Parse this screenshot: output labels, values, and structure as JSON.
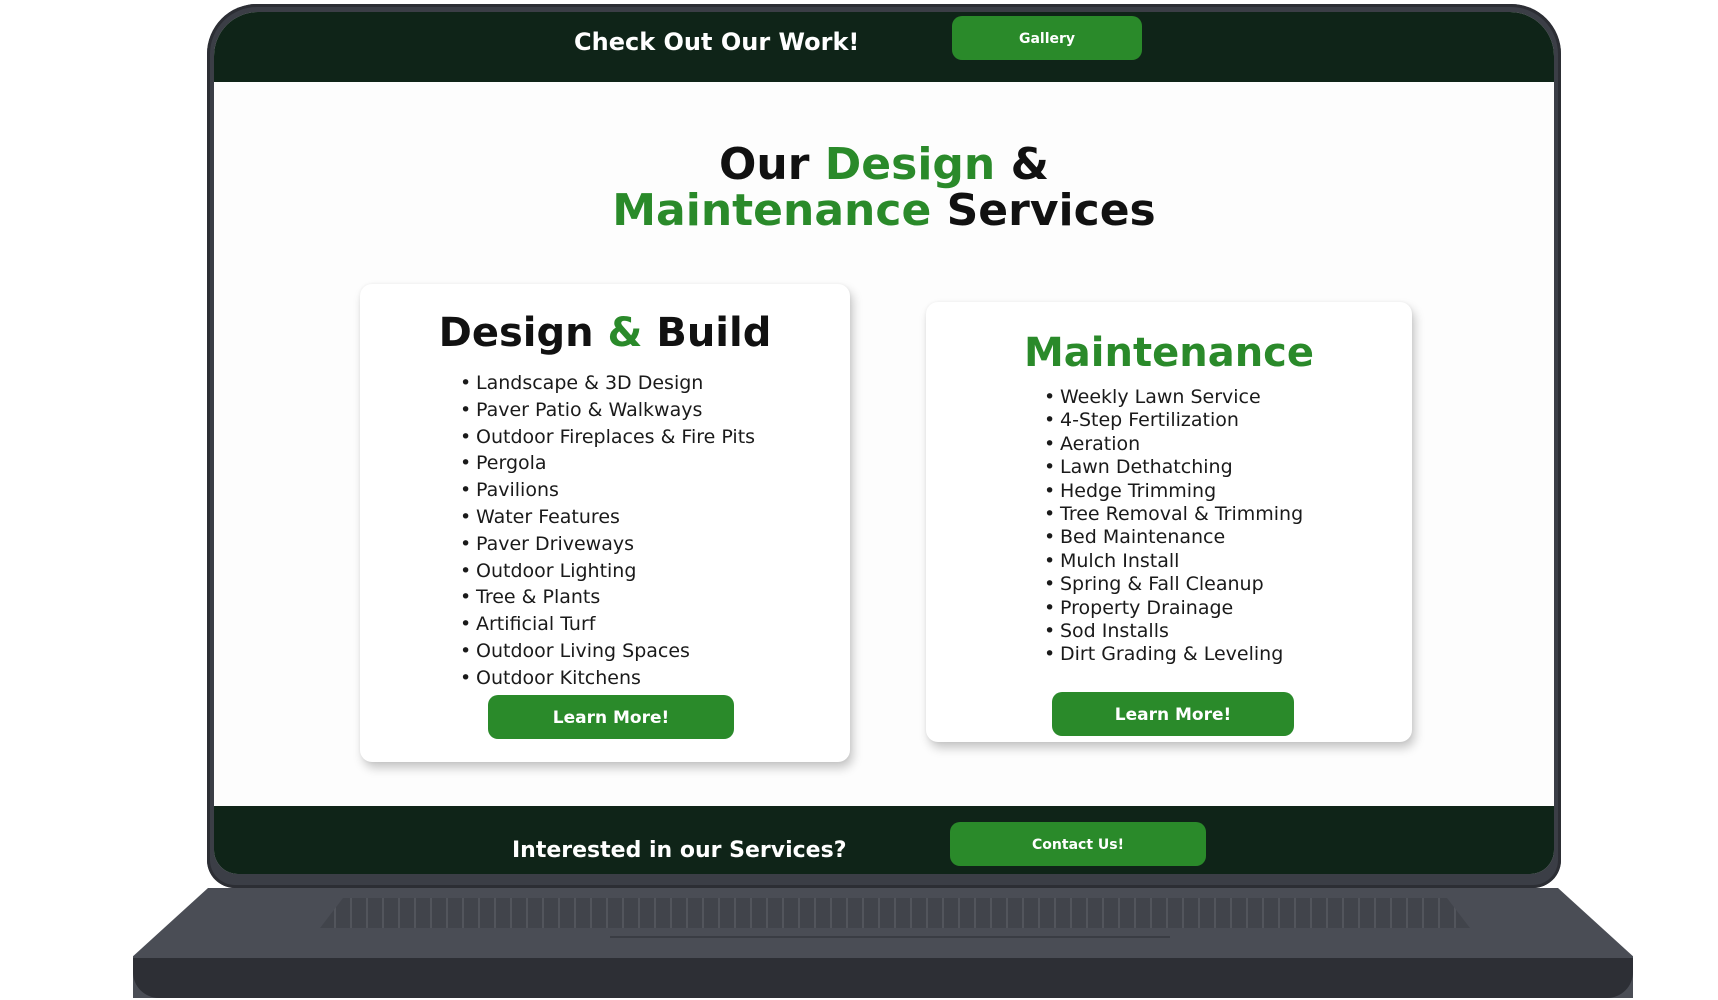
{
  "topbar": {
    "title": "Check Out Our Work!",
    "gallery_label": "Gallery"
  },
  "heading": {
    "line1_a": "Our ",
    "line1_b": "Design",
    "line1_c": " &",
    "line2_a": "Maintenance",
    "line2_b": " Services"
  },
  "design_build": {
    "title_a": "Design ",
    "title_b": "&",
    "title_c": " Build",
    "items": [
      "Landscape & 3D Design",
      "Paver Patio & Walkways",
      "Outdoor Fireplaces & Fire Pits",
      "Pergola",
      "Pavilions",
      "Water Features",
      "Paver Driveways",
      "Outdoor Lighting",
      "Tree & Plants",
      "Artificial Turf",
      "Outdoor Living Spaces",
      "Outdoor Kitchens"
    ],
    "button_label": "Learn More!"
  },
  "maintenance": {
    "title": "Maintenance",
    "items": [
      "Weekly Lawn Service",
      "4-Step Fertilization",
      "Aeration",
      "Lawn Dethatching",
      "Hedge Trimming",
      "Tree Removal & Trimming",
      "Bed Maintenance",
      "Mulch Install",
      "Spring & Fall Cleanup",
      "Property Drainage",
      "Sod Installs",
      "Dirt Grading & Leveling"
    ],
    "button_label": "Learn More!"
  },
  "bottombar": {
    "title": "Interested in our Services?",
    "contact_label": "Contact Us!"
  },
  "colors": {
    "accent": "#2a8a2a",
    "bar": "#0f2418",
    "frame": "#3b3e46"
  }
}
